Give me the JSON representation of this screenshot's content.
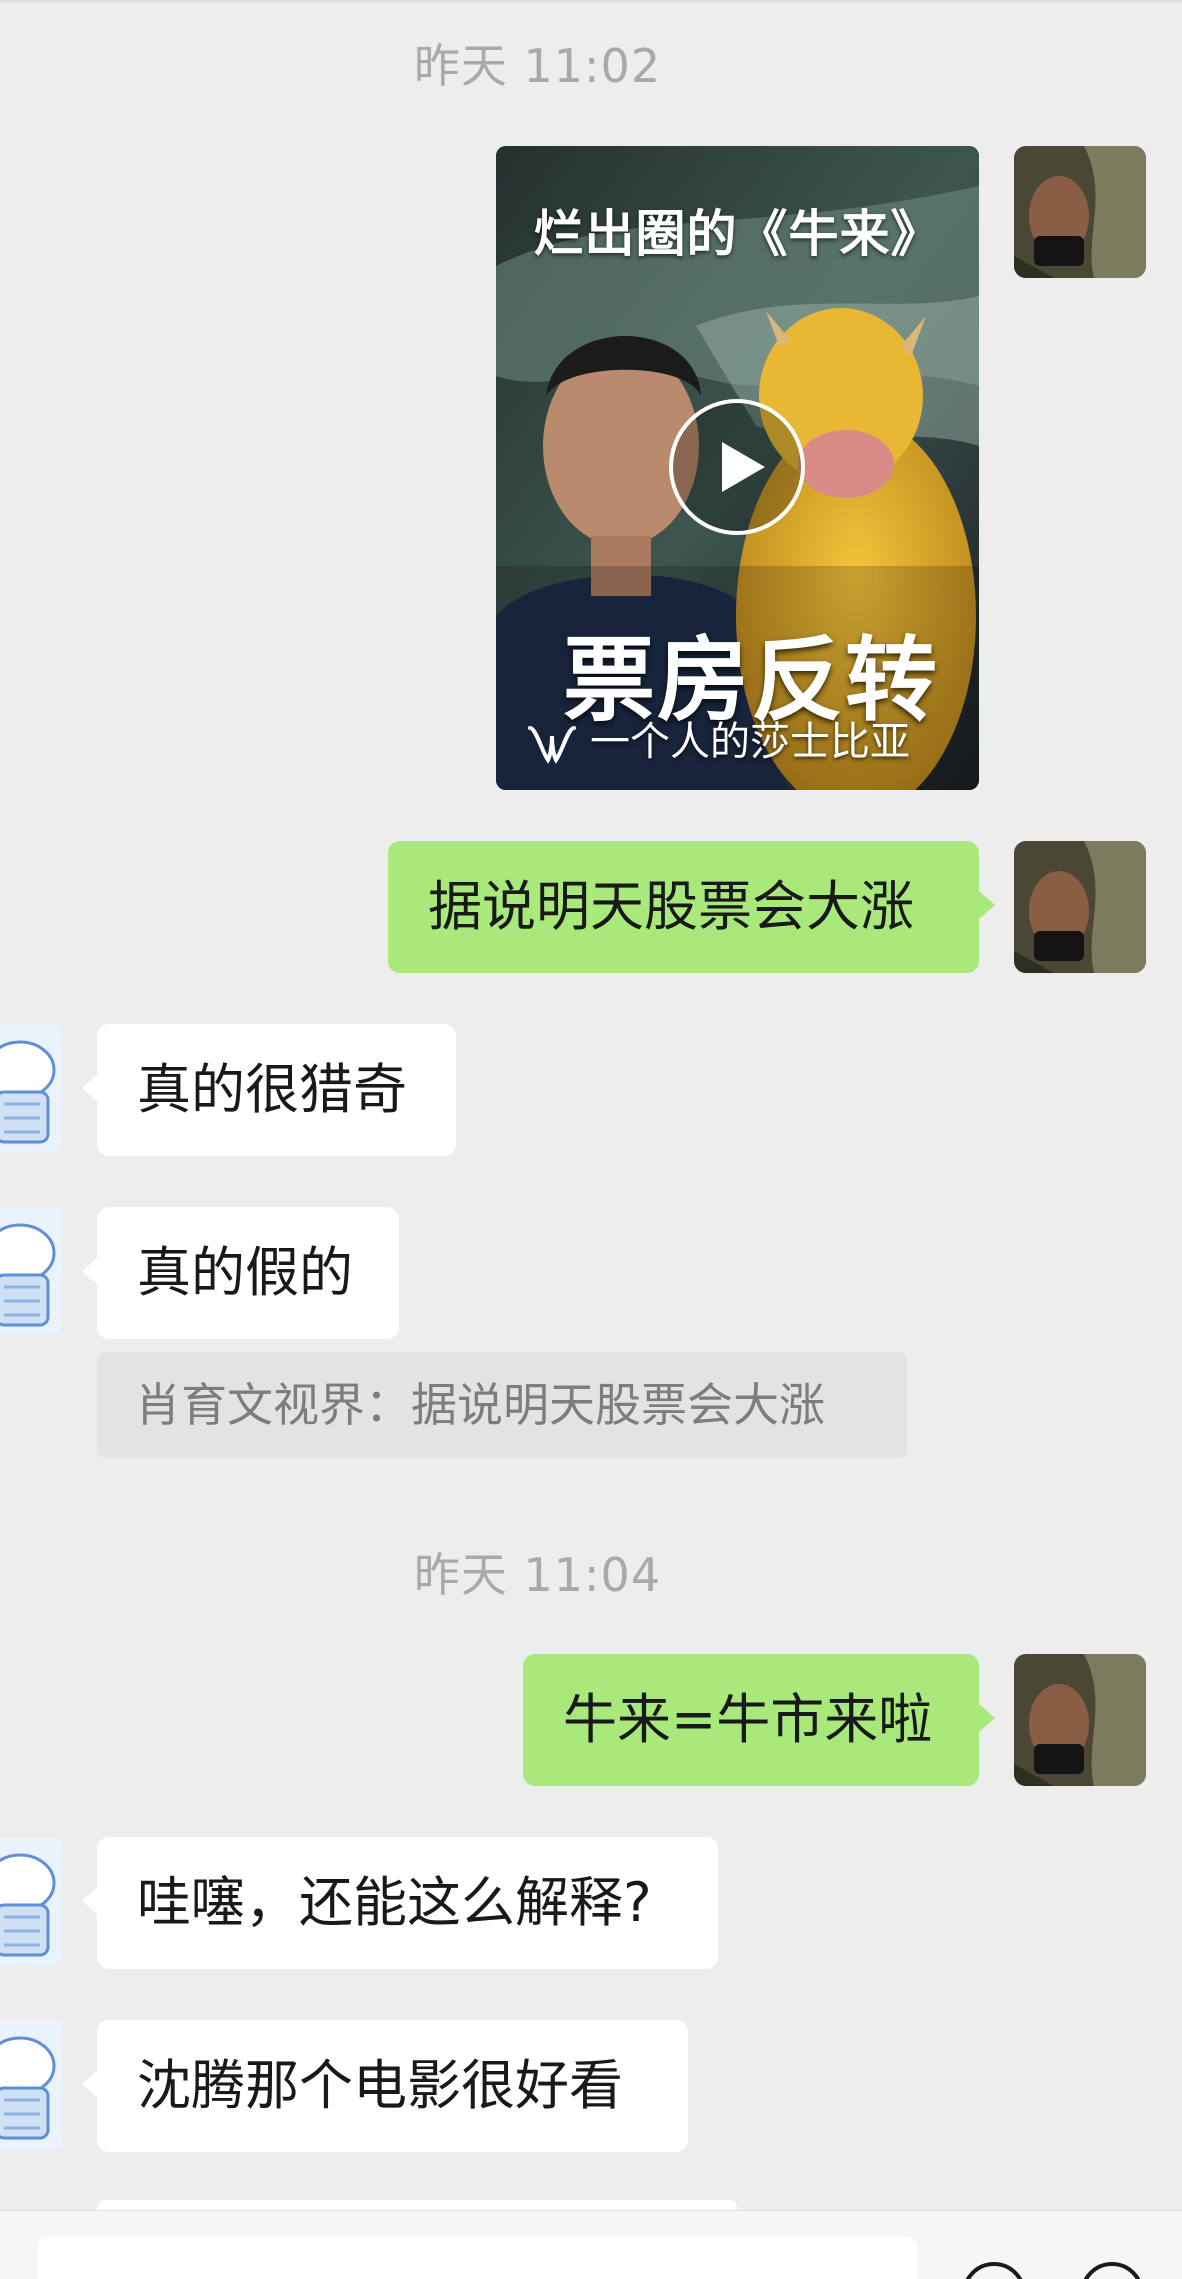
{
  "chat": {
    "timestamp_1": "昨天 11:02",
    "timestamp_2": "昨天 11:04",
    "video": {
      "title": "烂出圈的《牛来》",
      "big_text": "票房反转",
      "channel": "一个人的莎士比亚"
    },
    "messages": [
      {
        "side": "right",
        "text": "据说明天股票会大涨"
      },
      {
        "side": "left",
        "text": "真的很猎奇"
      },
      {
        "side": "left",
        "text": "真的假的"
      },
      {
        "side": "right",
        "text": "牛来=牛市来啦"
      },
      {
        "side": "left",
        "text": "哇噻，还能这么解释?"
      },
      {
        "side": "left",
        "text": "沈腾那个电影很好看"
      }
    ],
    "quote": "肖育文视界：据说明天股票会大涨"
  },
  "colors": {
    "background": "#ededed",
    "sent_bubble": "#a9e87b",
    "received_bubble": "#ffffff",
    "timestamp_text": "#a9a9a9",
    "quote_background": "#e3e3e3"
  },
  "icons": {
    "play": "play-circle-icon",
    "channel": "video-channel-icon"
  }
}
